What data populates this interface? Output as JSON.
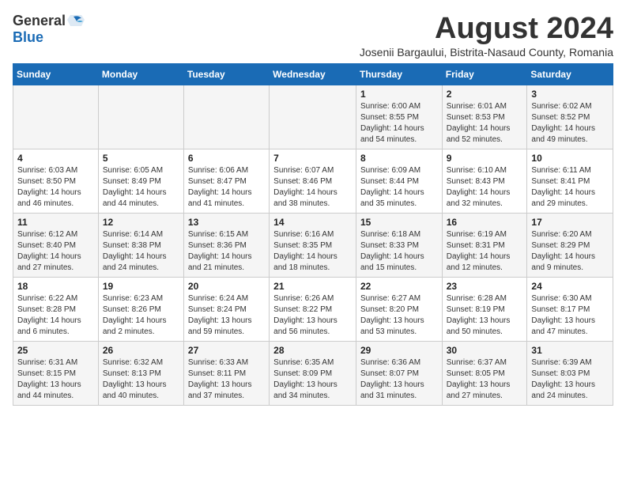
{
  "logo": {
    "general": "General",
    "blue": "Blue"
  },
  "title": "August 2024",
  "subtitle": "Josenii Bargaului, Bistrita-Nasaud County, Romania",
  "days": [
    "Sunday",
    "Monday",
    "Tuesday",
    "Wednesday",
    "Thursday",
    "Friday",
    "Saturday"
  ],
  "weeks": [
    [
      {
        "day": "",
        "content": ""
      },
      {
        "day": "",
        "content": ""
      },
      {
        "day": "",
        "content": ""
      },
      {
        "day": "",
        "content": ""
      },
      {
        "day": "1",
        "content": "Sunrise: 6:00 AM\nSunset: 8:55 PM\nDaylight: 14 hours\nand 54 minutes."
      },
      {
        "day": "2",
        "content": "Sunrise: 6:01 AM\nSunset: 8:53 PM\nDaylight: 14 hours\nand 52 minutes."
      },
      {
        "day": "3",
        "content": "Sunrise: 6:02 AM\nSunset: 8:52 PM\nDaylight: 14 hours\nand 49 minutes."
      }
    ],
    [
      {
        "day": "4",
        "content": "Sunrise: 6:03 AM\nSunset: 8:50 PM\nDaylight: 14 hours\nand 46 minutes."
      },
      {
        "day": "5",
        "content": "Sunrise: 6:05 AM\nSunset: 8:49 PM\nDaylight: 14 hours\nand 44 minutes."
      },
      {
        "day": "6",
        "content": "Sunrise: 6:06 AM\nSunset: 8:47 PM\nDaylight: 14 hours\nand 41 minutes."
      },
      {
        "day": "7",
        "content": "Sunrise: 6:07 AM\nSunset: 8:46 PM\nDaylight: 14 hours\nand 38 minutes."
      },
      {
        "day": "8",
        "content": "Sunrise: 6:09 AM\nSunset: 8:44 PM\nDaylight: 14 hours\nand 35 minutes."
      },
      {
        "day": "9",
        "content": "Sunrise: 6:10 AM\nSunset: 8:43 PM\nDaylight: 14 hours\nand 32 minutes."
      },
      {
        "day": "10",
        "content": "Sunrise: 6:11 AM\nSunset: 8:41 PM\nDaylight: 14 hours\nand 29 minutes."
      }
    ],
    [
      {
        "day": "11",
        "content": "Sunrise: 6:12 AM\nSunset: 8:40 PM\nDaylight: 14 hours\nand 27 minutes."
      },
      {
        "day": "12",
        "content": "Sunrise: 6:14 AM\nSunset: 8:38 PM\nDaylight: 14 hours\nand 24 minutes."
      },
      {
        "day": "13",
        "content": "Sunrise: 6:15 AM\nSunset: 8:36 PM\nDaylight: 14 hours\nand 21 minutes."
      },
      {
        "day": "14",
        "content": "Sunrise: 6:16 AM\nSunset: 8:35 PM\nDaylight: 14 hours\nand 18 minutes."
      },
      {
        "day": "15",
        "content": "Sunrise: 6:18 AM\nSunset: 8:33 PM\nDaylight: 14 hours\nand 15 minutes."
      },
      {
        "day": "16",
        "content": "Sunrise: 6:19 AM\nSunset: 8:31 PM\nDaylight: 14 hours\nand 12 minutes."
      },
      {
        "day": "17",
        "content": "Sunrise: 6:20 AM\nSunset: 8:29 PM\nDaylight: 14 hours\nand 9 minutes."
      }
    ],
    [
      {
        "day": "18",
        "content": "Sunrise: 6:22 AM\nSunset: 8:28 PM\nDaylight: 14 hours\nand 6 minutes."
      },
      {
        "day": "19",
        "content": "Sunrise: 6:23 AM\nSunset: 8:26 PM\nDaylight: 14 hours\nand 2 minutes."
      },
      {
        "day": "20",
        "content": "Sunrise: 6:24 AM\nSunset: 8:24 PM\nDaylight: 13 hours\nand 59 minutes."
      },
      {
        "day": "21",
        "content": "Sunrise: 6:26 AM\nSunset: 8:22 PM\nDaylight: 13 hours\nand 56 minutes."
      },
      {
        "day": "22",
        "content": "Sunrise: 6:27 AM\nSunset: 8:20 PM\nDaylight: 13 hours\nand 53 minutes."
      },
      {
        "day": "23",
        "content": "Sunrise: 6:28 AM\nSunset: 8:19 PM\nDaylight: 13 hours\nand 50 minutes."
      },
      {
        "day": "24",
        "content": "Sunrise: 6:30 AM\nSunset: 8:17 PM\nDaylight: 13 hours\nand 47 minutes."
      }
    ],
    [
      {
        "day": "25",
        "content": "Sunrise: 6:31 AM\nSunset: 8:15 PM\nDaylight: 13 hours\nand 44 minutes."
      },
      {
        "day": "26",
        "content": "Sunrise: 6:32 AM\nSunset: 8:13 PM\nDaylight: 13 hours\nand 40 minutes."
      },
      {
        "day": "27",
        "content": "Sunrise: 6:33 AM\nSunset: 8:11 PM\nDaylight: 13 hours\nand 37 minutes."
      },
      {
        "day": "28",
        "content": "Sunrise: 6:35 AM\nSunset: 8:09 PM\nDaylight: 13 hours\nand 34 minutes."
      },
      {
        "day": "29",
        "content": "Sunrise: 6:36 AM\nSunset: 8:07 PM\nDaylight: 13 hours\nand 31 minutes."
      },
      {
        "day": "30",
        "content": "Sunrise: 6:37 AM\nSunset: 8:05 PM\nDaylight: 13 hours\nand 27 minutes."
      },
      {
        "day": "31",
        "content": "Sunrise: 6:39 AM\nSunset: 8:03 PM\nDaylight: 13 hours\nand 24 minutes."
      }
    ]
  ]
}
